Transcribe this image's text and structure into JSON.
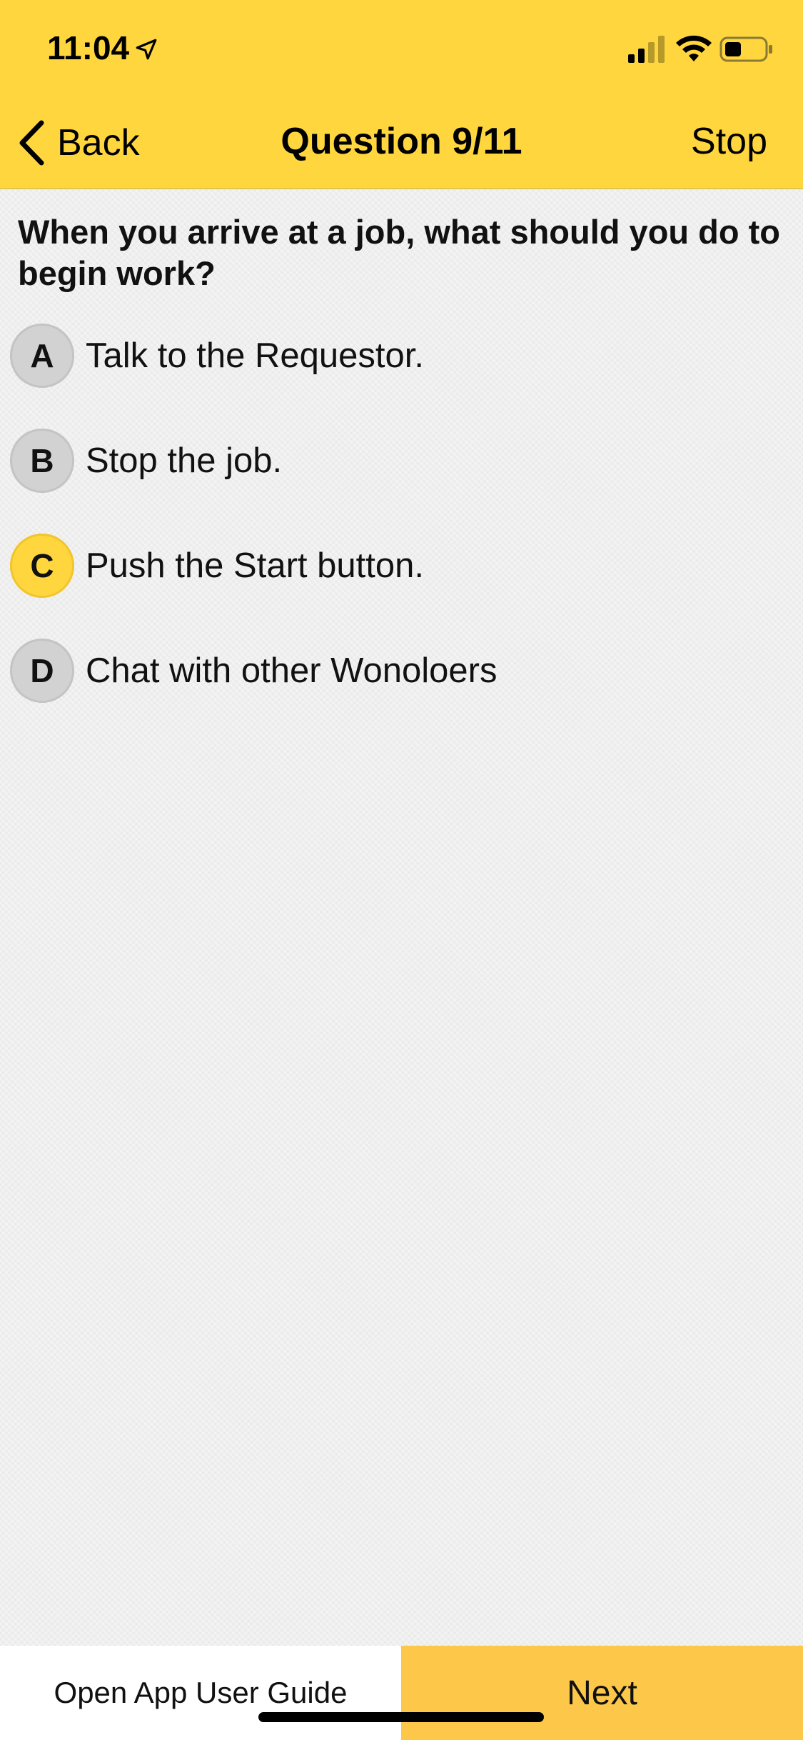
{
  "status_bar": {
    "time": "11:04"
  },
  "nav": {
    "back_label": "Back",
    "title": "Question 9/11",
    "stop_label": "Stop"
  },
  "question": {
    "text": "When you arrive at a job, what should you do to begin work?"
  },
  "options": [
    {
      "letter": "A",
      "text": "Talk to the Requestor.",
      "selected": false
    },
    {
      "letter": "B",
      "text": "Stop the job.",
      "selected": false
    },
    {
      "letter": "C",
      "text": "Push the Start button.",
      "selected": true
    },
    {
      "letter": "D",
      "text": "Chat with other Wonoloers",
      "selected": false
    }
  ],
  "footer": {
    "guide_label": "Open App User Guide",
    "next_label": "Next"
  },
  "colors": {
    "brand_yellow": "#ffd63d",
    "next_yellow": "#fdc84a",
    "option_gray": "#d2d2d2"
  },
  "icons": [
    "location-arrow-icon",
    "cellular-signal-icon",
    "wifi-icon",
    "battery-icon",
    "back-chevron-icon"
  ]
}
